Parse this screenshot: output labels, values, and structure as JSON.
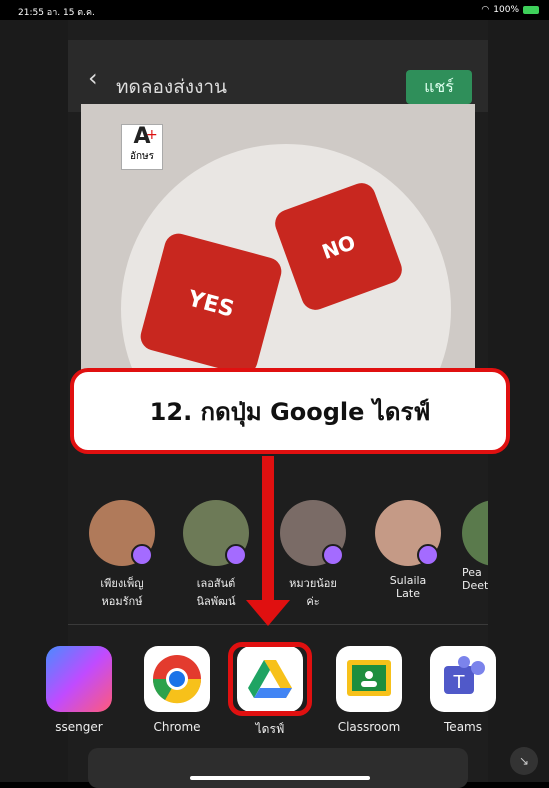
{
  "status": {
    "time": "21:55  อา. 15 ต.ค.",
    "battery": "100%"
  },
  "header": {
    "title": "ทดลองส่งงาน",
    "share_label": "แชร์"
  },
  "image": {
    "logo_text": "อักษร",
    "dice_text": [
      "YES",
      "NO",
      "YES",
      "NO",
      "YES",
      "NO"
    ]
  },
  "callout": "12. กดปุ่ม Google ไดรฟ์",
  "contacts": [
    {
      "line1": "เพียงเพ็ญ",
      "line2": "หอมรักษ์"
    },
    {
      "line1": "เลอสันต์",
      "line2": "นิลพัฒน์"
    },
    {
      "line1": "หมวยน้อย",
      "line2": "ค่ะ"
    },
    {
      "line1": "Sulaila",
      "line2": "Late"
    },
    {
      "line1": "Pea",
      "line2": "Deet"
    }
  ],
  "apps": [
    {
      "label": "ssenger",
      "icon": "messenger-icon"
    },
    {
      "label": "Chrome",
      "icon": "chrome-icon"
    },
    {
      "label": "ไดรฟ์",
      "icon": "google-drive-icon"
    },
    {
      "label": "Classroom",
      "icon": "classroom-icon"
    },
    {
      "label": "Teams",
      "icon": "teams-icon"
    }
  ],
  "colors": {
    "accent_red": "#e01010",
    "share_green": "#2f8f5a"
  }
}
